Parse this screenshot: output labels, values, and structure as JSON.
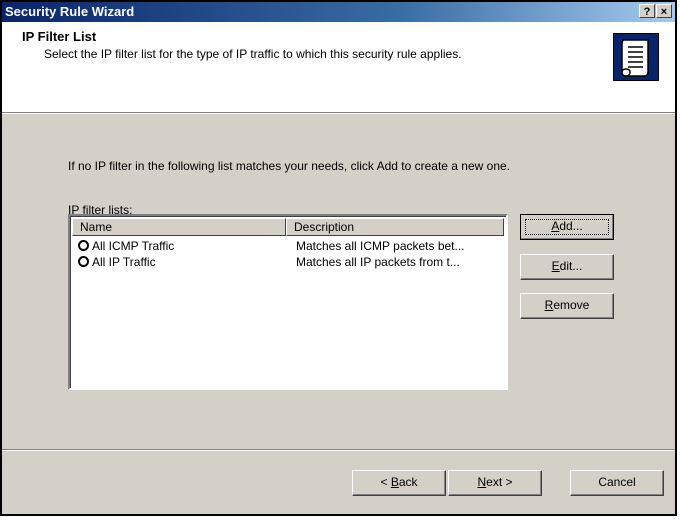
{
  "window": {
    "title": "Security Rule Wizard",
    "help_label": "?",
    "close_label": "×"
  },
  "header": {
    "title": "IP Filter List",
    "subtitle": "Select the IP filter list for the type of IP traffic to which this security rule applies.",
    "icon": "scroll-icon"
  },
  "body": {
    "intro": "If no IP filter in the following list matches your needs, click Add to create a new one.",
    "list_label_mnemonic": "I",
    "list_label_rest": "P filter lists:"
  },
  "list": {
    "columns": [
      "Name",
      "Description"
    ],
    "rows": [
      {
        "name": "All ICMP Traffic",
        "description": "Matches all ICMP packets bet..."
      },
      {
        "name": "All IP Traffic",
        "description": "Matches all IP packets from t..."
      }
    ]
  },
  "buttons": {
    "add": {
      "mnemonic": "A",
      "rest": "dd..."
    },
    "edit": {
      "mnemonic": "E",
      "rest": "dit..."
    },
    "remove": {
      "mnemonic": "R",
      "rest": "emove"
    },
    "back": {
      "prefix": "< ",
      "mnemonic": "B",
      "rest": "ack"
    },
    "next": {
      "mnemonic": "N",
      "rest": "ext >"
    },
    "cancel": "Cancel"
  }
}
